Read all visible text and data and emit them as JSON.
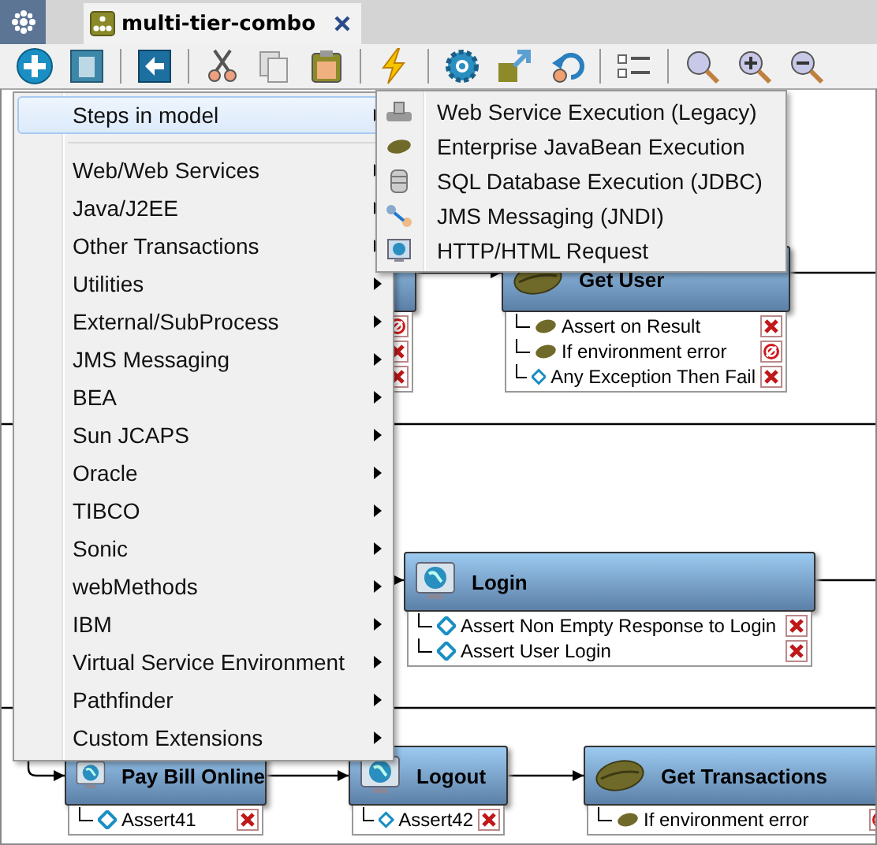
{
  "tabs": [
    {
      "label": "multi-tier-combo",
      "selected": true,
      "closable": true
    }
  ],
  "menu": {
    "items": [
      {
        "label": "Steps in model",
        "selected": true,
        "submenu": true,
        "separator_after": true
      },
      {
        "label": "Web/Web Services",
        "selected": false,
        "submenu": true
      },
      {
        "label": "Java/J2EE",
        "selected": false,
        "submenu": true
      },
      {
        "label": "Other Transactions",
        "selected": false,
        "submenu": true
      },
      {
        "label": "Utilities",
        "selected": false,
        "submenu": true
      },
      {
        "label": "External/SubProcess",
        "selected": false,
        "submenu": true
      },
      {
        "label": "JMS Messaging",
        "selected": false,
        "submenu": true
      },
      {
        "label": "BEA",
        "selected": false,
        "submenu": true
      },
      {
        "label": "Sun JCAPS",
        "selected": false,
        "submenu": true
      },
      {
        "label": "Oracle",
        "selected": false,
        "submenu": true
      },
      {
        "label": "TIBCO",
        "selected": false,
        "submenu": true
      },
      {
        "label": "Sonic",
        "selected": false,
        "submenu": true
      },
      {
        "label": "webMethods",
        "selected": false,
        "submenu": true
      },
      {
        "label": "IBM",
        "selected": false,
        "submenu": true
      },
      {
        "label": "Virtual Service Environment",
        "selected": false,
        "submenu": true
      },
      {
        "label": "Pathfinder",
        "selected": false,
        "submenu": true
      },
      {
        "label": "Custom Extensions",
        "selected": false,
        "submenu": true
      }
    ]
  },
  "submenu": {
    "items": [
      {
        "label": "Web Service Execution (Legacy)",
        "kind": "webservice"
      },
      {
        "label": "Enterprise JavaBean Execution",
        "kind": "bean"
      },
      {
        "label": "SQL Database Execution (JDBC)",
        "kind": "database"
      },
      {
        "label": "JMS Messaging (JNDI)",
        "kind": "jms"
      },
      {
        "label": "HTTP/HTML Request",
        "kind": "web"
      }
    ]
  },
  "nodes": [
    {
      "assertions": [
        {
          "aborted": true
        },
        {
          "aborted": false
        },
        {
          "aborted": false
        }
      ]
    },
    {
      "title": "Get User",
      "kind": "bean",
      "assertions": [
        {
          "label": "Assert on Result",
          "kind": "bean",
          "aborted": false
        },
        {
          "label": "If environment error",
          "kind": "bean",
          "aborted": true
        },
        {
          "label": "Any Exception Then Fail",
          "kind": "diamond",
          "aborted": false
        }
      ]
    },
    {
      "title": "Login",
      "kind": "web",
      "assertions": [
        {
          "label": "Assert Non Empty Response to Login",
          "kind": "diamond",
          "aborted": false
        },
        {
          "label": "Assert User Login",
          "kind": "diamond",
          "aborted": false
        }
      ]
    },
    {
      "title": "Pay Bill Online",
      "kind": "web",
      "assertions": [
        {
          "label": "Assert41",
          "kind": "diamond",
          "aborted": false
        }
      ]
    },
    {
      "title": "Logout",
      "kind": "web",
      "assertions": [
        {
          "label": "Assert42",
          "kind": "diamond",
          "aborted": false
        }
      ]
    },
    {
      "title": "Get Transactions",
      "kind": "bean",
      "assertions": [
        {
          "label": "If environment error",
          "kind": "bean",
          "aborted": true
        }
      ]
    }
  ]
}
